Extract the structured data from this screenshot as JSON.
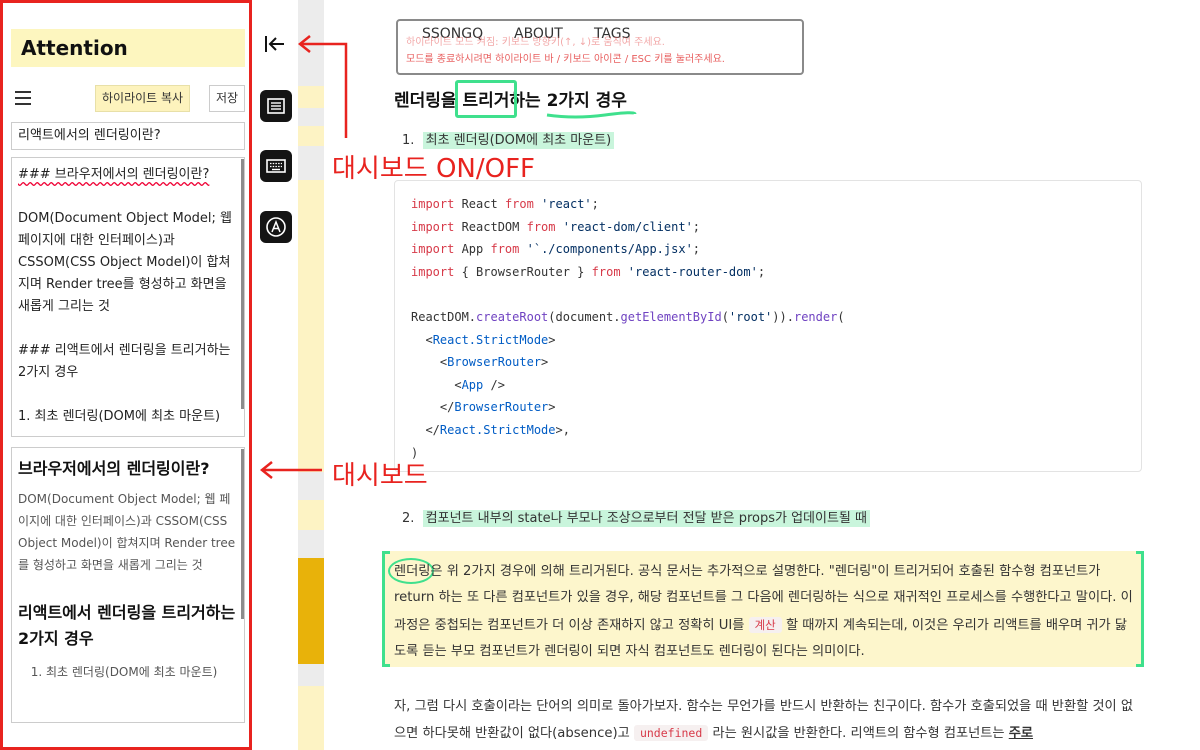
{
  "dashboard": {
    "title": "Attention",
    "copy_highlight_label": "하이라이트 복사",
    "save_label": "저장",
    "page_title_value": "리액트에서의 렌더링이란?",
    "markdown_lines": [
      "### 브라우저에서의 렌더링이란?",
      "DOM(Document Object Model; 웹 페이지에 대한 인터페이스)과 CSSOM(CSS Object Model)이 합쳐지며 Render tree를 형성하고 화면을 새롭게 그리는 것",
      "### 리액트에서 렌더링을 트리거하는 2가지 경우",
      "1. 최초 렌더링(DOM에 최초 마운트)"
    ],
    "preview": {
      "heading1": "브라우저에서의 렌더링이란?",
      "body1": "DOM(Document Object Model; 웹 페이지에 대한 인터페이스)과 CSSOM(CSS Object Model)이 합쳐지며 Render tree를 형성하고 화면을 새롭게 그리는 것",
      "heading2": "리액트에서 렌더링을 트리거하는 2가지 경우",
      "item1": "최초 렌더링(DOM에 최초 마운트)"
    }
  },
  "rail": {
    "icons": [
      "collapse-sidebar-icon",
      "dashboard-icon",
      "keyboard-icon",
      "highlight-mode-icon"
    ]
  },
  "nav": {
    "links": [
      "SSONGQ",
      "ABOUT",
      "TAGS"
    ],
    "hint_line1": "하이라이트 모드 켜짐: 키보드 방향키(↑, ↓)로 움직여 주세요.",
    "hint_line2": "모드를 종료하시려면 하이라이트 바 / 키보드 아이콘 / ESC 키를 눌러주세요."
  },
  "article": {
    "heading": "렌더링을 트리거하는 2가지 경우",
    "list_item_1_num": "1.",
    "list_item_1": "최초 렌더링(DOM에 최초 마운트)",
    "list_item_2_num": "2.",
    "list_item_2": "컴포넌트 내부의 state나 부모나 조상으로부터 전달 받은 props가 업데이트될 때",
    "code_lines": [
      "import React from 'react';",
      "import ReactDOM from 'react-dom/client';",
      "import App from '`./components/App.jsx';",
      "import { BrowserRouter } from 'react-router-dom';",
      "",
      "ReactDOM.createRoot(document.getElementById('root')).render(",
      "  <React.StrictMode>",
      "    <BrowserRouter>",
      "      <App />",
      "    </BrowserRouter>",
      "  </React.StrictMode>,",
      ")"
    ],
    "para1_a": "렌더링은 위 2가지 경우에 의해 트리거된다. 공식 문서는 추가적으로 설명한다. \"렌더링\"이 트리거되어 호출된 함수형 컴포넌트가 return 하는 또 다른 컴포넌트가 있을 경우, 해당 컴포넌트를 그 다음에 렌더링하는 식으로 재귀적인 프로세스를 수행한다고 말이다. 이 과정은 중첩되는 컴포넌트가 더 이상 존재하지 않고 정확히 UI를",
    "para1_code": "계산",
    "para1_b": "할 때까지 계속되는데, 이것은 우리가 리액트를 배우며 귀가 닳도록 듣는 부모 컴포넌트가 렌더링이 되면 자식 컴포넌트도 렌더링이 된다는 의미이다.",
    "para2_a": "자, 그럼 다시 호출이라는 단어의 의미로 돌아가보자. 함수는 무언가를 반드시 반환하는 친구이다. 함수가 호출되었을 때 반환할 것이 없으면 하다못해 반환값이 없다(absence)고",
    "para2_code": "undefined",
    "para2_b": "라는 원시값을 반환한다. 리액트의 함수형 컴포넌트는",
    "para2_c": "주로"
  },
  "annotations": {
    "dashboard_toggle": "대시보드 ON/OFF",
    "dashboard": "대시보드"
  },
  "colors": {
    "annotation_red": "#e8231f",
    "highlight_yellow": "#fdf6cc",
    "highlight_green": "#c9f5dc",
    "marker_green": "#3fe08d",
    "bar_active": "#e8b20a",
    "bar_light": "#fdf3c4"
  }
}
